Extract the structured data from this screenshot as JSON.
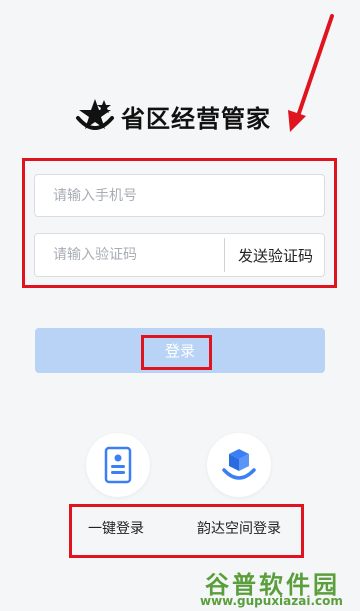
{
  "app": {
    "brand_name": "省区经营管家"
  },
  "form": {
    "phone_placeholder": "请输入手机号",
    "code_placeholder": "请输入验证码",
    "send_code_label": "发送验证码",
    "login_label": "登录"
  },
  "alt_login": {
    "one_click_label": "一键登录",
    "yunda_space_label": "韵达空间登录"
  },
  "watermark": {
    "brand": "谷普软件园",
    "url": "www.gupuxiazai.com"
  },
  "colors": {
    "accent_red": "#e0141e",
    "login_button": "#b9d3f6",
    "icon_blue": "#3b7ff5"
  },
  "icons": {
    "logo": "star-smile-logo-icon",
    "one_click": "phone-card-icon",
    "yunda": "cube-smile-icon"
  }
}
